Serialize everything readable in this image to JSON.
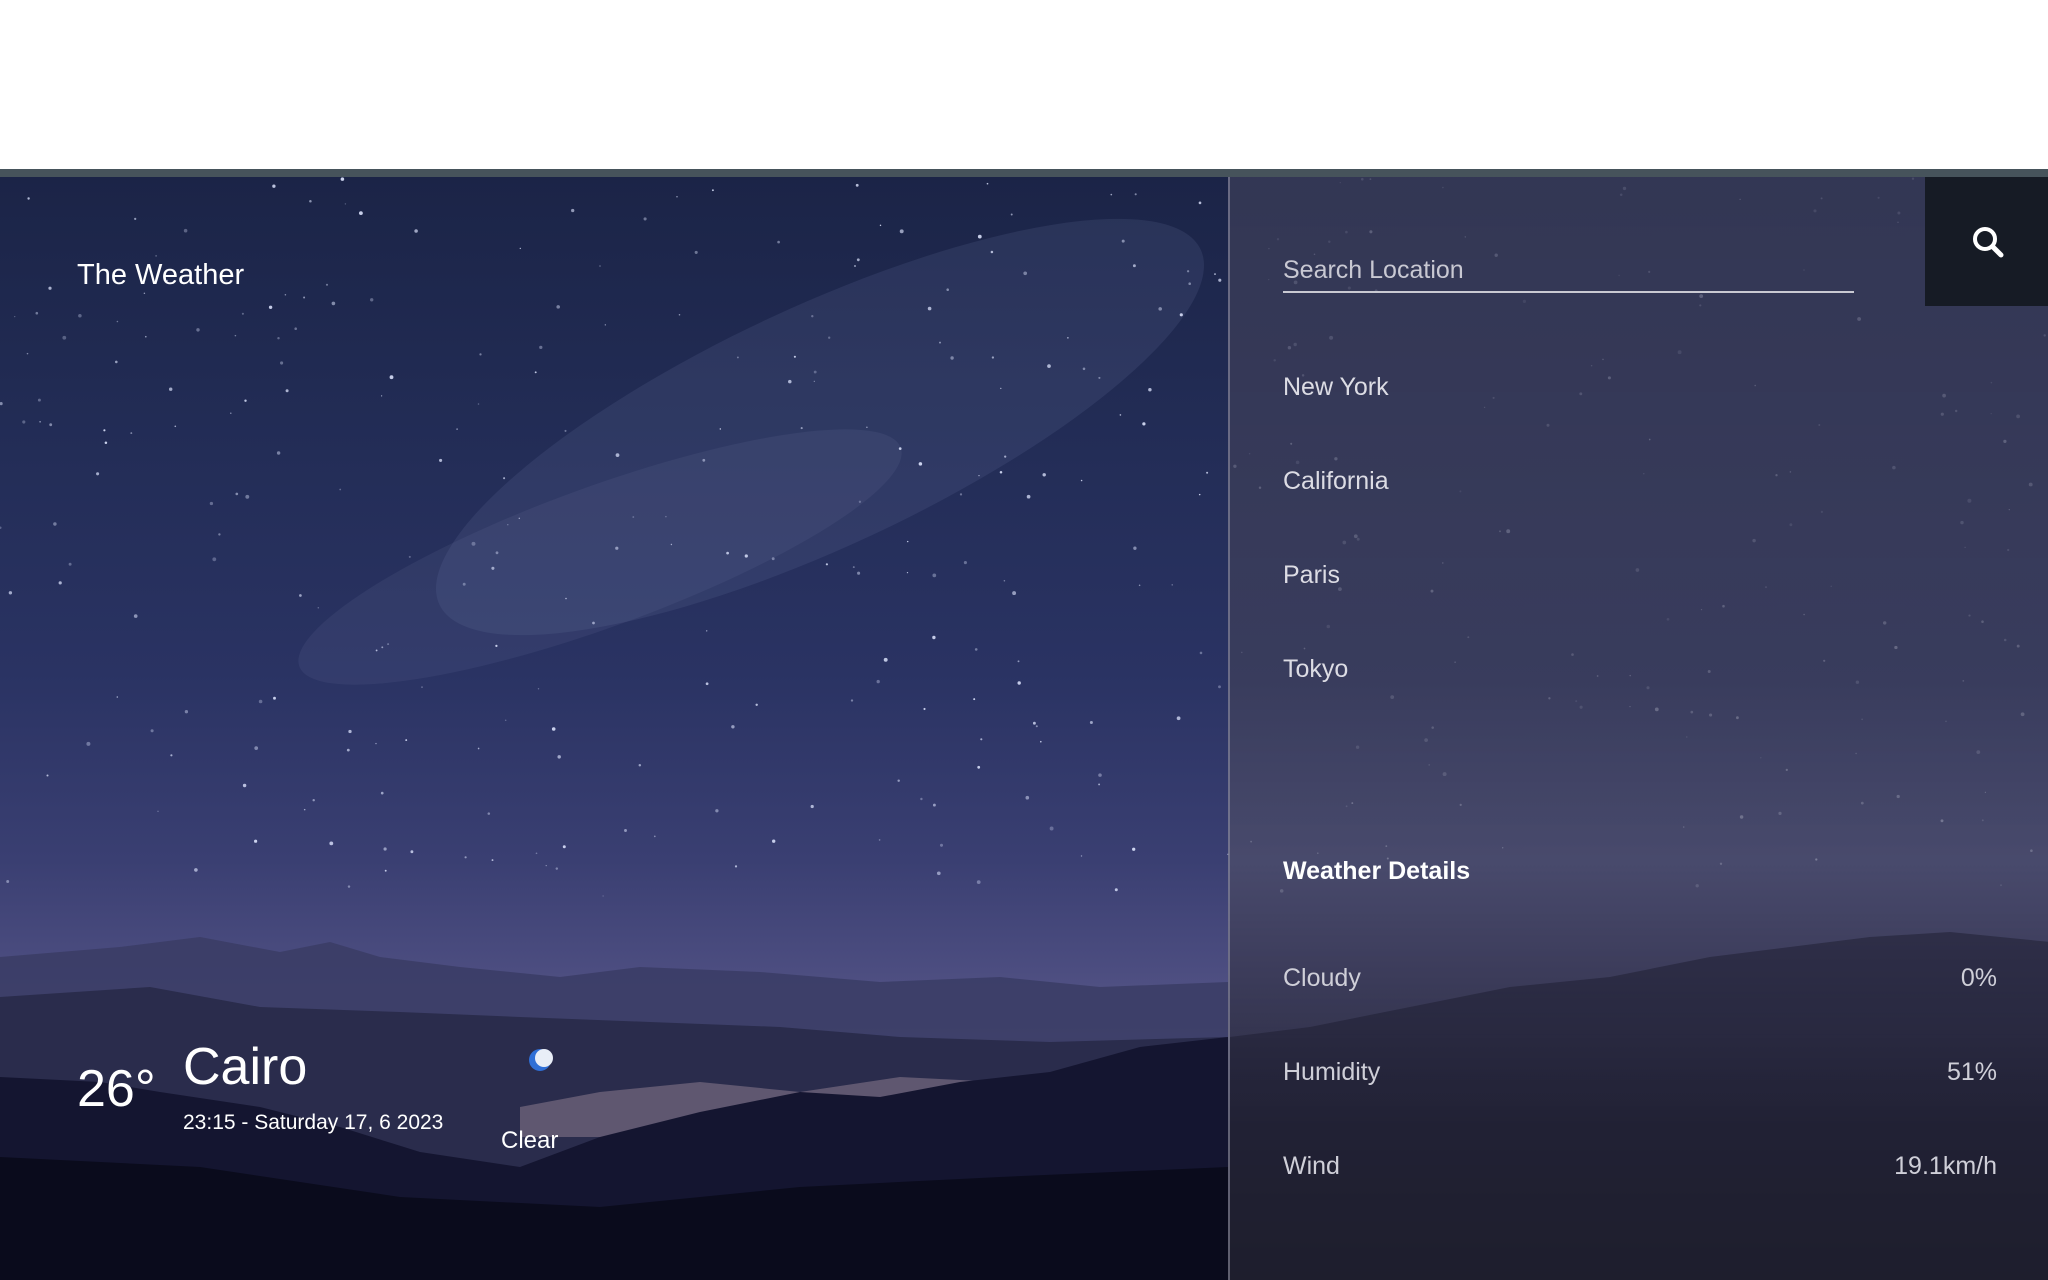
{
  "app": {
    "title": "The Weather"
  },
  "current": {
    "temperature": "26°",
    "city": "Cairo",
    "datetime": "23:15 - Saturday 17, 6 2023",
    "condition": "Clear",
    "condition_icon": "moon-icon"
  },
  "search": {
    "placeholder": "Search Location",
    "value": "",
    "button_icon": "search-icon"
  },
  "locations": [
    "New York",
    "California",
    "Paris",
    "Tokyo"
  ],
  "details": {
    "title": "Weather Details",
    "rows": [
      {
        "label": "Cloudy",
        "value": "0%"
      },
      {
        "label": "Humidity",
        "value": "51%"
      },
      {
        "label": "Wind",
        "value": "19.1km/h"
      }
    ]
  },
  "colors": {
    "top_rule": "#46535b",
    "search_button_bg": "#161b25",
    "sky": "#222c55"
  }
}
